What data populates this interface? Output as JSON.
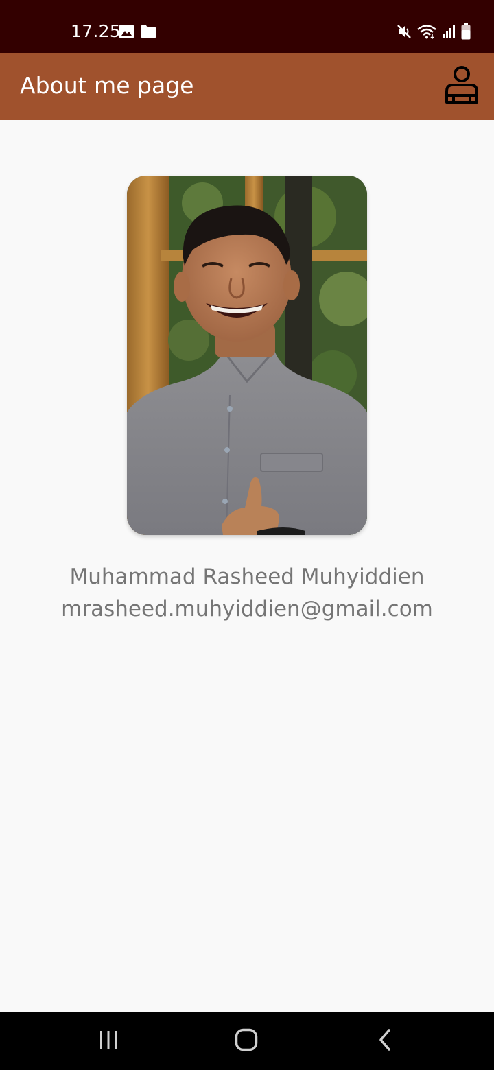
{
  "status_bar": {
    "time": "17.25",
    "icons": [
      "image-icon",
      "folder-icon",
      "mute-icon",
      "wifi-icon",
      "signal-icon",
      "battery-icon"
    ]
  },
  "app_bar": {
    "title": "About me page",
    "action_icon": "person-icon"
  },
  "profile": {
    "name": "Muhammad Rasheed Muhyiddien",
    "email": "mrasheed.muhyiddien@gmail.com"
  },
  "nav_bar": {
    "icons": [
      "recents-icon",
      "home-icon",
      "back-icon"
    ]
  },
  "colors": {
    "status_bar": "#330000",
    "app_bar": "#a0522d",
    "background": "#f9f9f9",
    "text_secondary": "#757575",
    "nav_bar": "#000000"
  }
}
